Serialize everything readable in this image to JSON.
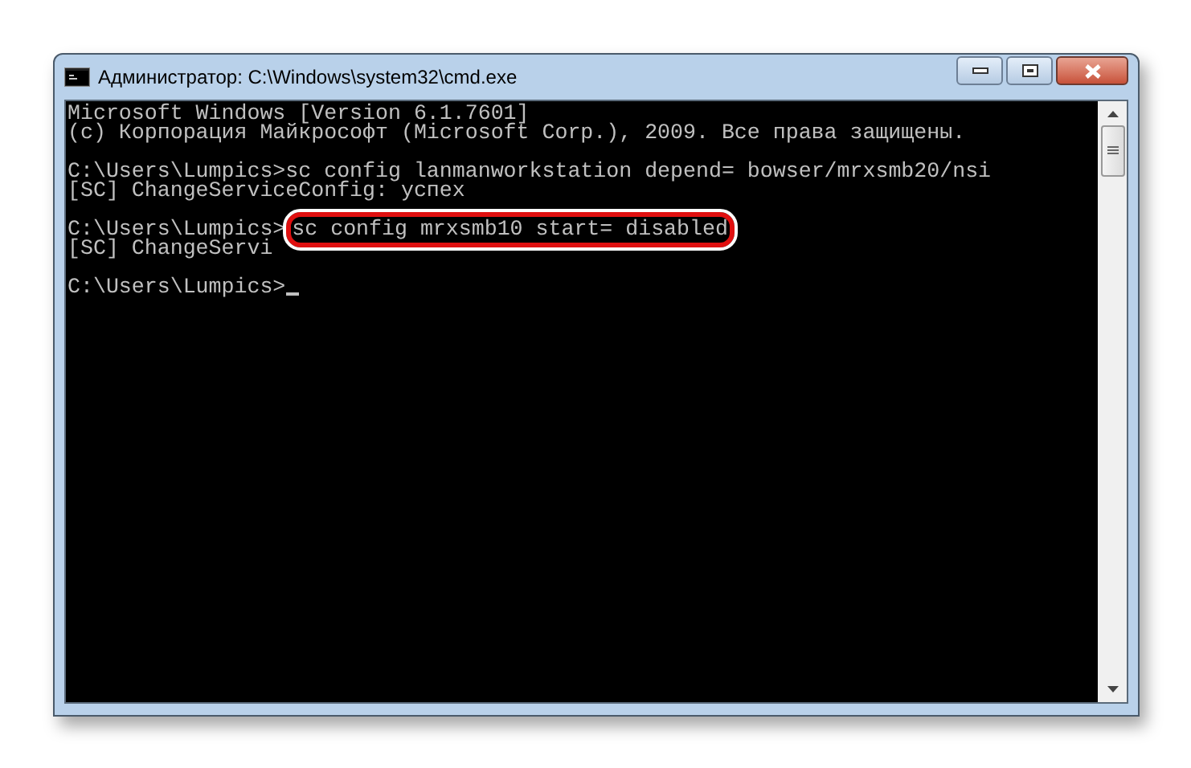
{
  "window": {
    "title": "Администратор: C:\\Windows\\system32\\cmd.exe"
  },
  "console": {
    "blocks": [
      [
        {
          "text": "Microsoft Windows [Version 6.1.7601]"
        },
        {
          "text": "(c) Корпорация Майкрософт (Microsoft Corp.), 2009. Все права защищены."
        }
      ],
      [
        {
          "prompt": "C:\\Users\\Lumpics>",
          "command": "sc config lanmanworkstation depend= bowser/mrxsmb20/nsi",
          "highlighted": false
        },
        {
          "text": "[SC] ChangeServiceConfig: успех"
        }
      ],
      [
        {
          "prompt": "C:\\Users\\Lumpics>",
          "command": "sc config mrxsmb10 start= disabled",
          "highlighted": true
        },
        {
          "text": "[SC] ChangeServi"
        }
      ],
      [
        {
          "prompt": "C:\\Users\\Lumpics>",
          "cursor": true
        }
      ]
    ]
  }
}
